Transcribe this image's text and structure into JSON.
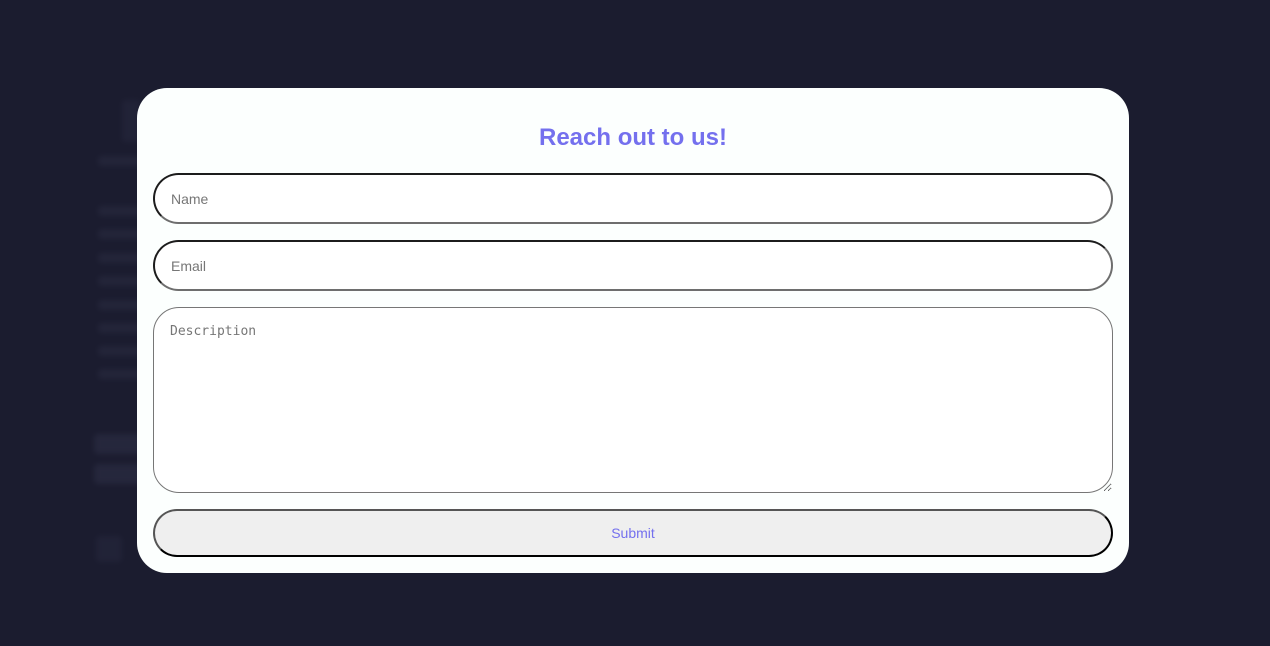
{
  "form": {
    "title": "Reach out to us!",
    "name_placeholder": "Name",
    "name_value": "",
    "email_placeholder": "Email",
    "email_value": "",
    "description_placeholder": "Description",
    "description_value": "",
    "submit_label": "Submit"
  },
  "colors": {
    "backdrop": "#1b1c2f",
    "modal_background": "#fcfffe",
    "accent": "#7470ee",
    "button_background": "#efefef"
  }
}
